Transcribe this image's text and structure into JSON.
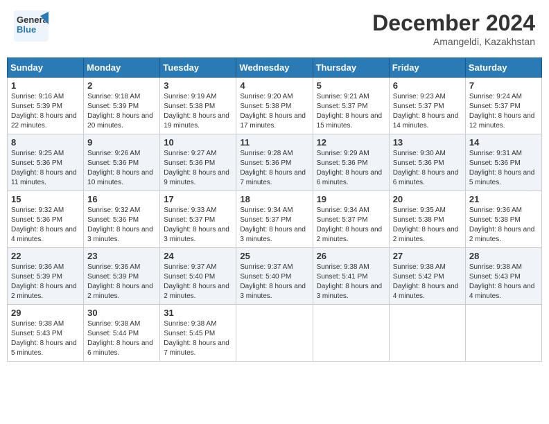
{
  "logo": {
    "line1": "General",
    "line2": "Blue"
  },
  "title": "December 2024",
  "location": "Amangeldi, Kazakhstan",
  "weekdays": [
    "Sunday",
    "Monday",
    "Tuesday",
    "Wednesday",
    "Thursday",
    "Friday",
    "Saturday"
  ],
  "weeks": [
    [
      {
        "day": "1",
        "sunrise": "9:16 AM",
        "sunset": "5:39 PM",
        "daylight": "8 hours and 22 minutes."
      },
      {
        "day": "2",
        "sunrise": "9:18 AM",
        "sunset": "5:39 PM",
        "daylight": "8 hours and 20 minutes."
      },
      {
        "day": "3",
        "sunrise": "9:19 AM",
        "sunset": "5:38 PM",
        "daylight": "8 hours and 19 minutes."
      },
      {
        "day": "4",
        "sunrise": "9:20 AM",
        "sunset": "5:38 PM",
        "daylight": "8 hours and 17 minutes."
      },
      {
        "day": "5",
        "sunrise": "9:21 AM",
        "sunset": "5:37 PM",
        "daylight": "8 hours and 15 minutes."
      },
      {
        "day": "6",
        "sunrise": "9:23 AM",
        "sunset": "5:37 PM",
        "daylight": "8 hours and 14 minutes."
      },
      {
        "day": "7",
        "sunrise": "9:24 AM",
        "sunset": "5:37 PM",
        "daylight": "8 hours and 12 minutes."
      }
    ],
    [
      {
        "day": "8",
        "sunrise": "9:25 AM",
        "sunset": "5:36 PM",
        "daylight": "8 hours and 11 minutes."
      },
      {
        "day": "9",
        "sunrise": "9:26 AM",
        "sunset": "5:36 PM",
        "daylight": "8 hours and 10 minutes."
      },
      {
        "day": "10",
        "sunrise": "9:27 AM",
        "sunset": "5:36 PM",
        "daylight": "8 hours and 9 minutes."
      },
      {
        "day": "11",
        "sunrise": "9:28 AM",
        "sunset": "5:36 PM",
        "daylight": "8 hours and 7 minutes."
      },
      {
        "day": "12",
        "sunrise": "9:29 AM",
        "sunset": "5:36 PM",
        "daylight": "8 hours and 6 minutes."
      },
      {
        "day": "13",
        "sunrise": "9:30 AM",
        "sunset": "5:36 PM",
        "daylight": "8 hours and 6 minutes."
      },
      {
        "day": "14",
        "sunrise": "9:31 AM",
        "sunset": "5:36 PM",
        "daylight": "8 hours and 5 minutes."
      }
    ],
    [
      {
        "day": "15",
        "sunrise": "9:32 AM",
        "sunset": "5:36 PM",
        "daylight": "8 hours and 4 minutes."
      },
      {
        "day": "16",
        "sunrise": "9:32 AM",
        "sunset": "5:36 PM",
        "daylight": "8 hours and 3 minutes."
      },
      {
        "day": "17",
        "sunrise": "9:33 AM",
        "sunset": "5:37 PM",
        "daylight": "8 hours and 3 minutes."
      },
      {
        "day": "18",
        "sunrise": "9:34 AM",
        "sunset": "5:37 PM",
        "daylight": "8 hours and 3 minutes."
      },
      {
        "day": "19",
        "sunrise": "9:34 AM",
        "sunset": "5:37 PM",
        "daylight": "8 hours and 2 minutes."
      },
      {
        "day": "20",
        "sunrise": "9:35 AM",
        "sunset": "5:38 PM",
        "daylight": "8 hours and 2 minutes."
      },
      {
        "day": "21",
        "sunrise": "9:36 AM",
        "sunset": "5:38 PM",
        "daylight": "8 hours and 2 minutes."
      }
    ],
    [
      {
        "day": "22",
        "sunrise": "9:36 AM",
        "sunset": "5:39 PM",
        "daylight": "8 hours and 2 minutes."
      },
      {
        "day": "23",
        "sunrise": "9:36 AM",
        "sunset": "5:39 PM",
        "daylight": "8 hours and 2 minutes."
      },
      {
        "day": "24",
        "sunrise": "9:37 AM",
        "sunset": "5:40 PM",
        "daylight": "8 hours and 2 minutes."
      },
      {
        "day": "25",
        "sunrise": "9:37 AM",
        "sunset": "5:40 PM",
        "daylight": "8 hours and 3 minutes."
      },
      {
        "day": "26",
        "sunrise": "9:38 AM",
        "sunset": "5:41 PM",
        "daylight": "8 hours and 3 minutes."
      },
      {
        "day": "27",
        "sunrise": "9:38 AM",
        "sunset": "5:42 PM",
        "daylight": "8 hours and 4 minutes."
      },
      {
        "day": "28",
        "sunrise": "9:38 AM",
        "sunset": "5:43 PM",
        "daylight": "8 hours and 4 minutes."
      }
    ],
    [
      {
        "day": "29",
        "sunrise": "9:38 AM",
        "sunset": "5:43 PM",
        "daylight": "8 hours and 5 minutes."
      },
      {
        "day": "30",
        "sunrise": "9:38 AM",
        "sunset": "5:44 PM",
        "daylight": "8 hours and 6 minutes."
      },
      {
        "day": "31",
        "sunrise": "9:38 AM",
        "sunset": "5:45 PM",
        "daylight": "8 hours and 7 minutes."
      },
      null,
      null,
      null,
      null
    ]
  ],
  "labels": {
    "sunrise": "Sunrise:",
    "sunset": "Sunset:",
    "daylight": "Daylight:"
  }
}
